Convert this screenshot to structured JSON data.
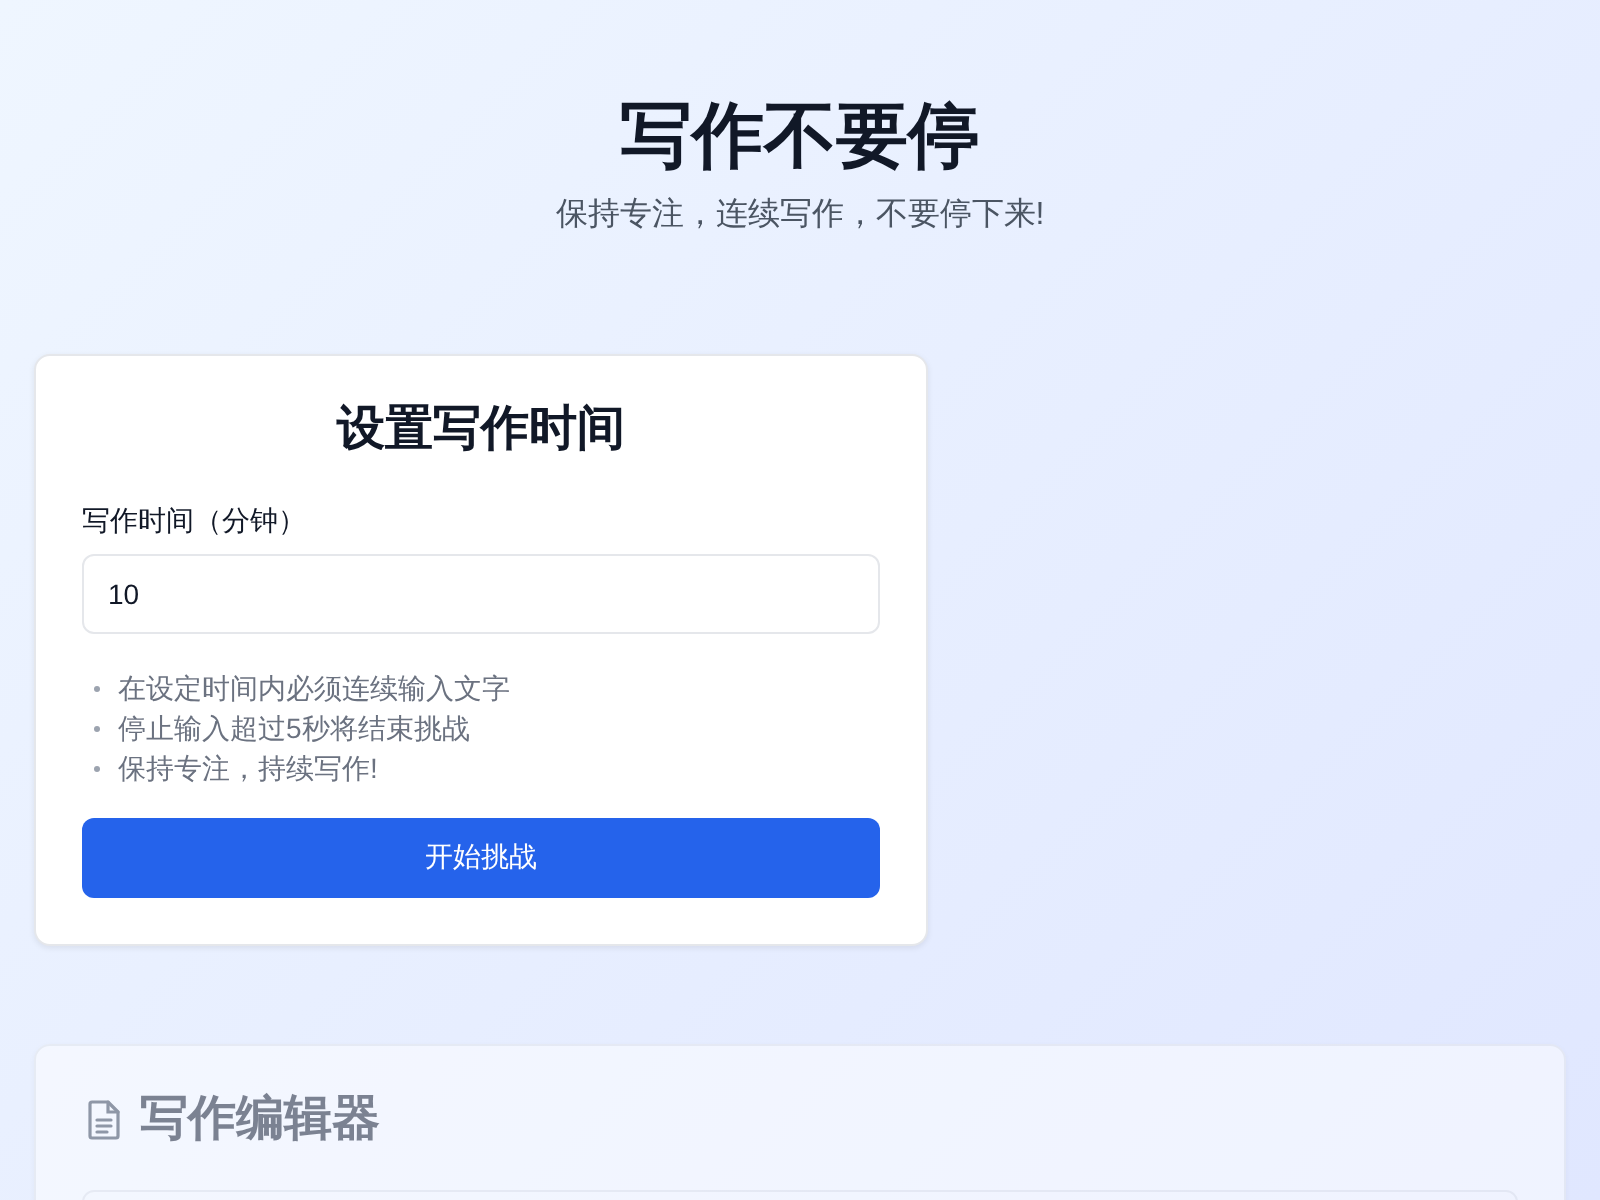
{
  "header": {
    "title": "写作不要停",
    "subtitle": "保持专注，连续写作，不要停下来!"
  },
  "setup": {
    "title": "设置写作时间",
    "duration_label": "写作时间（分钟）",
    "duration_value": "10",
    "rules": [
      "在设定时间内必须连续输入文字",
      "停止输入超过5秒将结束挑战",
      "保持专注，持续写作!"
    ],
    "start_button": "开始挑战"
  },
  "editor": {
    "title": "写作编辑器",
    "disabled": true
  }
}
